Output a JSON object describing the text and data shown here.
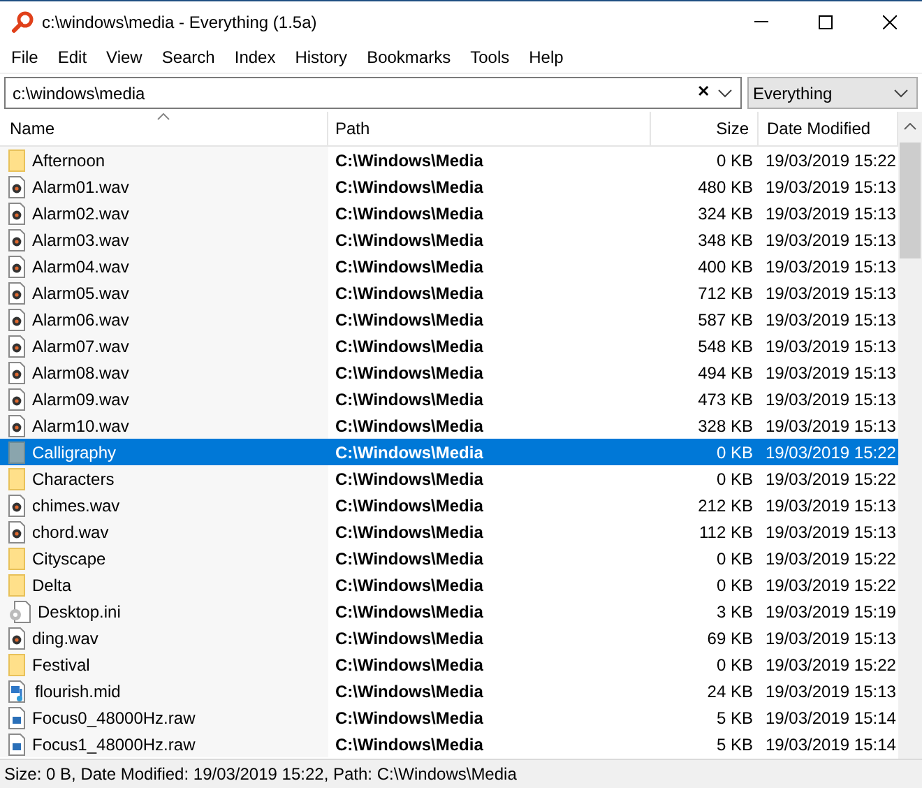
{
  "window": {
    "title": "c:\\windows\\media - Everything (1.5a)"
  },
  "menu": [
    "File",
    "Edit",
    "View",
    "Search",
    "Index",
    "History",
    "Bookmarks",
    "Tools",
    "Help"
  ],
  "search": {
    "value": "c:\\windows\\media",
    "clear": "✕"
  },
  "filter": {
    "value": "Everything"
  },
  "columns": [
    {
      "label": "Name",
      "sorted": true
    },
    {
      "label": "Path",
      "sorted": false
    },
    {
      "label": "Size",
      "sorted": false
    },
    {
      "label": "Date Modified",
      "sorted": false
    }
  ],
  "rows": [
    {
      "name": "Afternoon",
      "kind": "folder",
      "path": "C:\\Windows\\Media",
      "size": "0 KB",
      "date": "19/03/2019 15:22",
      "selected": false
    },
    {
      "name": "Alarm01.wav",
      "kind": "audio",
      "path": "C:\\Windows\\Media",
      "size": "480 KB",
      "date": "19/03/2019 15:13",
      "selected": false
    },
    {
      "name": "Alarm02.wav",
      "kind": "audio",
      "path": "C:\\Windows\\Media",
      "size": "324 KB",
      "date": "19/03/2019 15:13",
      "selected": false
    },
    {
      "name": "Alarm03.wav",
      "kind": "audio",
      "path": "C:\\Windows\\Media",
      "size": "348 KB",
      "date": "19/03/2019 15:13",
      "selected": false
    },
    {
      "name": "Alarm04.wav",
      "kind": "audio",
      "path": "C:\\Windows\\Media",
      "size": "400 KB",
      "date": "19/03/2019 15:13",
      "selected": false
    },
    {
      "name": "Alarm05.wav",
      "kind": "audio",
      "path": "C:\\Windows\\Media",
      "size": "712 KB",
      "date": "19/03/2019 15:13",
      "selected": false
    },
    {
      "name": "Alarm06.wav",
      "kind": "audio",
      "path": "C:\\Windows\\Media",
      "size": "587 KB",
      "date": "19/03/2019 15:13",
      "selected": false
    },
    {
      "name": "Alarm07.wav",
      "kind": "audio",
      "path": "C:\\Windows\\Media",
      "size": "548 KB",
      "date": "19/03/2019 15:13",
      "selected": false
    },
    {
      "name": "Alarm08.wav",
      "kind": "audio",
      "path": "C:\\Windows\\Media",
      "size": "494 KB",
      "date": "19/03/2019 15:13",
      "selected": false
    },
    {
      "name": "Alarm09.wav",
      "kind": "audio",
      "path": "C:\\Windows\\Media",
      "size": "473 KB",
      "date": "19/03/2019 15:13",
      "selected": false
    },
    {
      "name": "Alarm10.wav",
      "kind": "audio",
      "path": "C:\\Windows\\Media",
      "size": "328 KB",
      "date": "19/03/2019 15:13",
      "selected": false
    },
    {
      "name": "Calligraphy",
      "kind": "folder",
      "path": "C:\\Windows\\Media",
      "size": "0 KB",
      "date": "19/03/2019 15:22",
      "selected": true
    },
    {
      "name": "Characters",
      "kind": "folder",
      "path": "C:\\Windows\\Media",
      "size": "0 KB",
      "date": "19/03/2019 15:22",
      "selected": false
    },
    {
      "name": "chimes.wav",
      "kind": "audio",
      "path": "C:\\Windows\\Media",
      "size": "212 KB",
      "date": "19/03/2019 15:13",
      "selected": false
    },
    {
      "name": "chord.wav",
      "kind": "audio",
      "path": "C:\\Windows\\Media",
      "size": "112 KB",
      "date": "19/03/2019 15:13",
      "selected": false
    },
    {
      "name": "Cityscape",
      "kind": "folder",
      "path": "C:\\Windows\\Media",
      "size": "0 KB",
      "date": "19/03/2019 15:22",
      "selected": false
    },
    {
      "name": "Delta",
      "kind": "folder",
      "path": "C:\\Windows\\Media",
      "size": "0 KB",
      "date": "19/03/2019 15:22",
      "selected": false
    },
    {
      "name": "Desktop.ini",
      "kind": "settings",
      "path": "C:\\Windows\\Media",
      "size": "3 KB",
      "date": "19/03/2019 15:19",
      "selected": false
    },
    {
      "name": "ding.wav",
      "kind": "audio",
      "path": "C:\\Windows\\Media",
      "size": "69 KB",
      "date": "19/03/2019 15:13",
      "selected": false
    },
    {
      "name": "Festival",
      "kind": "folder",
      "path": "C:\\Windows\\Media",
      "size": "0 KB",
      "date": "19/03/2019 15:22",
      "selected": false
    },
    {
      "name": "flourish.mid",
      "kind": "midi",
      "path": "C:\\Windows\\Media",
      "size": "24 KB",
      "date": "19/03/2019 15:13",
      "selected": false
    },
    {
      "name": "Focus0_48000Hz.raw",
      "kind": "raw",
      "path": "C:\\Windows\\Media",
      "size": "5 KB",
      "date": "19/03/2019 15:14",
      "selected": false
    },
    {
      "name": "Focus1_48000Hz.raw",
      "kind": "raw",
      "path": "C:\\Windows\\Media",
      "size": "5 KB",
      "date": "19/03/2019 15:14",
      "selected": false
    }
  ],
  "status_bar": "Size: 0 B, Date Modified: 19/03/2019 15:22, Path: C:\\Windows\\Media"
}
